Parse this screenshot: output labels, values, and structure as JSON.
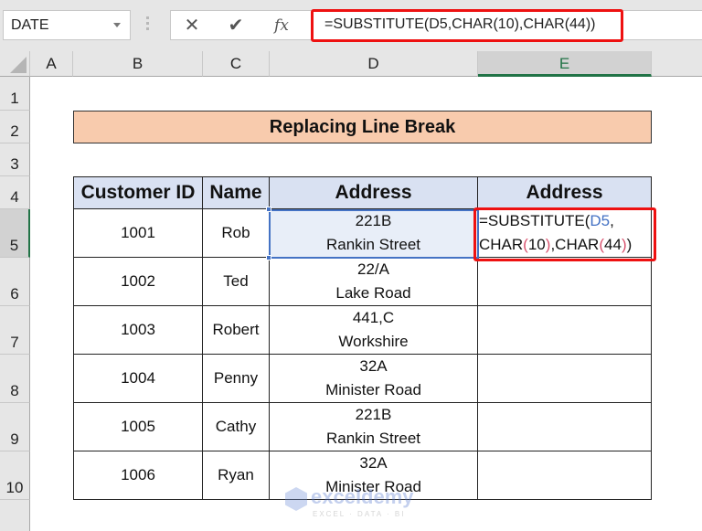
{
  "formula_bar": {
    "name_box": "DATE",
    "cancel_icon": "✕",
    "enter_icon": "✔",
    "fx_label": "fx",
    "formula": "=SUBSTITUTE(D5,CHAR(10),CHAR(44))"
  },
  "columns": [
    "A",
    "B",
    "C",
    "D",
    "E"
  ],
  "selected_column": "E",
  "rows": [
    "1",
    "2",
    "3",
    "4",
    "5",
    "6",
    "7",
    "8",
    "9",
    "10"
  ],
  "selected_row": "5",
  "title": "Replacing Line Break",
  "table": {
    "headers": [
      "Customer ID",
      "Name",
      "Address",
      "Address"
    ],
    "rows": [
      {
        "id": "1001",
        "name": "Rob",
        "addr1": "221B",
        "addr2": "Rankin Street"
      },
      {
        "id": "1002",
        "name": "Ted",
        "addr1": "22/A",
        "addr2": "Lake Road"
      },
      {
        "id": "1003",
        "name": "Robert",
        "addr1": "441,C",
        "addr2": "Workshire"
      },
      {
        "id": "1004",
        "name": "Penny",
        "addr1": "32A",
        "addr2": "Minister Road"
      },
      {
        "id": "1005",
        "name": "Cathy",
        "addr1": "221B",
        "addr2": "Rankin Street"
      },
      {
        "id": "1006",
        "name": "Ryan",
        "addr1": "32A",
        "addr2": "Minister Road"
      }
    ]
  },
  "editing_cell": {
    "line1_prefix": "=SUBSTITUTE(",
    "line1_ref": "D5",
    "line1_suffix": ",",
    "line2_a": "CHAR",
    "line2_p1": "(",
    "line2_n1": "10",
    "line2_p2": ")",
    "line2_b": ",CHAR",
    "line2_p3": "(",
    "line2_n2": "44",
    "line2_p4": ")",
    "line2_end": ")"
  },
  "watermark": {
    "brand": "exceldemy",
    "tagline": "EXCEL · DATA · BI"
  },
  "colors": {
    "accent_green": "#217346",
    "highlight_red": "#ee1111",
    "header_fill": "#d9e1f2",
    "title_fill": "#f8cbad"
  }
}
